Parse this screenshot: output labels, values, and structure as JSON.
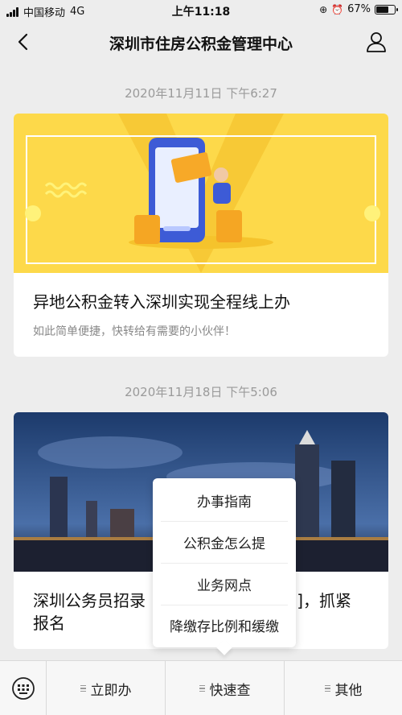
{
  "status_bar": {
    "carrier": "中国移动",
    "network": "4G",
    "time": "上午11:18",
    "battery": "67%",
    "battery_level": 0.67
  },
  "nav": {
    "title": "深圳市住房公积金管理中心",
    "back_icon": "chevron-left-icon",
    "profile_icon": "person-icon"
  },
  "messages": [
    {
      "timestamp": "2020年11月11日 下午6:27",
      "title": "异地公积金转入深圳实现全程线上办",
      "subtitle": "如此简单便捷，快转给有需要的小伙伴！"
    },
    {
      "timestamp": "2020年11月18日 下午5:06",
      "title_line1_left": "深圳公务员招录",
      "title_line1_right": "]，抓紧",
      "title_line2": "报名"
    }
  ],
  "popup_menu": {
    "items": [
      "办事指南",
      "公积金怎么提",
      "业务网点",
      "降缴存比例和缓缴"
    ]
  },
  "bottom_menu": {
    "keyboard_icon": "keyboard-icon",
    "items": [
      "立即办",
      "快速查",
      "其他"
    ]
  },
  "colors": {
    "banner_yellow": "#fdd94a",
    "night_sky": "#1c3a6b"
  }
}
